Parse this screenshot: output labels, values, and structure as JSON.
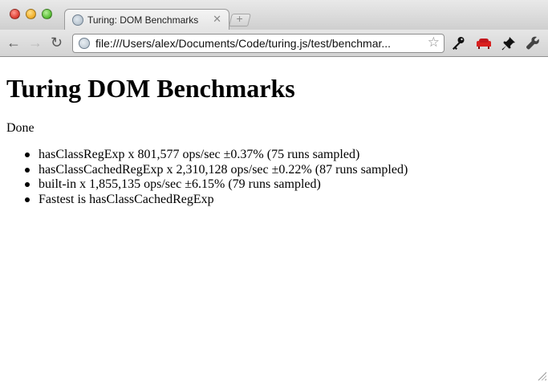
{
  "browser": {
    "tab": {
      "title": "Turing: DOM Benchmarks",
      "close_glyph": "✕",
      "favicon": "globe-icon"
    },
    "new_tab_glyph": "+",
    "toolbar": {
      "back_glyph": "←",
      "forward_glyph": "→",
      "reload_glyph": "↻"
    },
    "omnibox": {
      "url": "file:///Users/alex/Documents/Code/turing.js/test/benchmar...",
      "star_glyph": "☆"
    },
    "extensions": [
      "key-icon",
      "sofa-icon",
      "pin-icon",
      "wrench-icon"
    ]
  },
  "page": {
    "heading": "Turing DOM Benchmarks",
    "status": "Done",
    "results": [
      "hasClassRegExp x 801,577 ops/sec ±0.37% (75 runs sampled)",
      "hasClassCachedRegExp x 2,310,128 ops/sec ±0.22% (87 runs sampled)",
      "built-in x 1,855,135 ops/sec ±6.15% (79 runs sampled)",
      "Fastest is hasClassCachedRegExp"
    ]
  }
}
